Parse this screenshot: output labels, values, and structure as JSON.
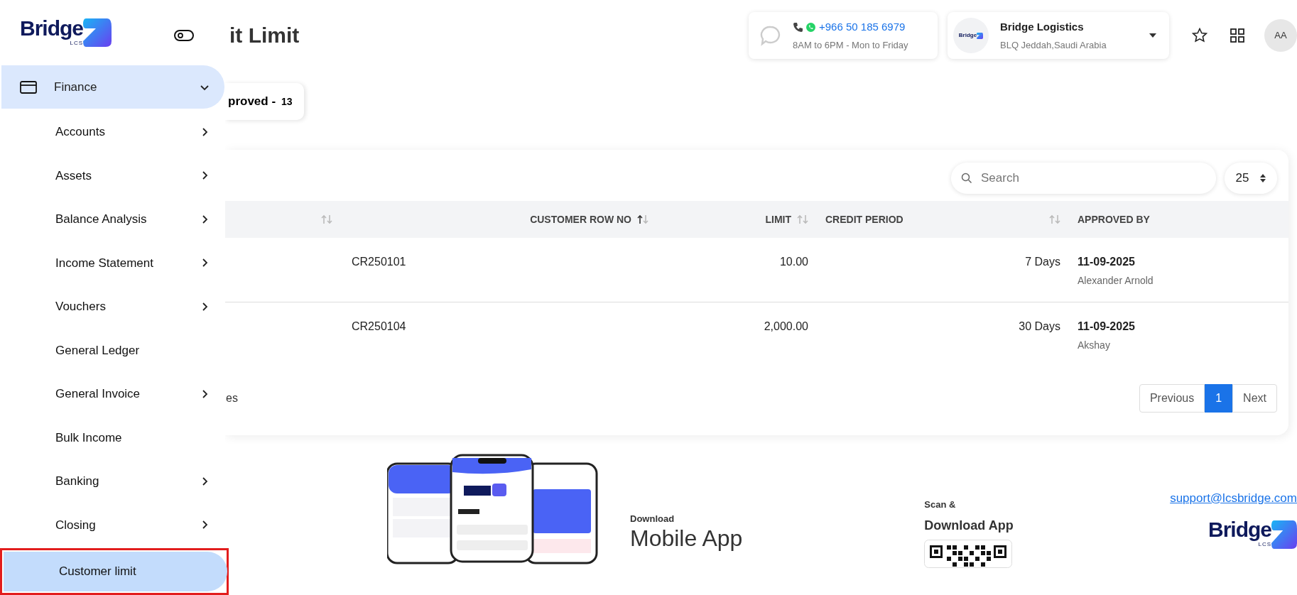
{
  "sidebar": {
    "logo": "Bridge",
    "logo_sub": "LCS",
    "section": {
      "label": "Finance",
      "expanded": true
    },
    "items": [
      {
        "label": "Accounts",
        "has_submenu": true,
        "selected": false,
        "outlined": false
      },
      {
        "label": "Assets",
        "has_submenu": true,
        "selected": false,
        "outlined": false
      },
      {
        "label": "Balance Analysis",
        "has_submenu": true,
        "selected": false,
        "outlined": false
      },
      {
        "label": "Income Statement",
        "has_submenu": true,
        "selected": false,
        "outlined": false
      },
      {
        "label": "Vouchers",
        "has_submenu": true,
        "selected": false,
        "outlined": false
      },
      {
        "label": "General Ledger",
        "has_submenu": false,
        "selected": false,
        "outlined": false
      },
      {
        "label": "General Invoice",
        "has_submenu": true,
        "selected": false,
        "outlined": false
      },
      {
        "label": "Bulk Income",
        "has_submenu": false,
        "selected": false,
        "outlined": false
      },
      {
        "label": "Banking",
        "has_submenu": true,
        "selected": false,
        "outlined": false
      },
      {
        "label": "Closing",
        "has_submenu": true,
        "selected": false,
        "outlined": false
      },
      {
        "label": "Customer limit",
        "has_submenu": false,
        "selected": true,
        "outlined": true
      }
    ]
  },
  "page": {
    "title": "it Limit"
  },
  "header": {
    "contact": {
      "phone": "+966 50 185 6979",
      "hours": "8AM to 6PM - Mon to Friday"
    },
    "company": {
      "logo": "Bridge",
      "name": "Bridge Logistics",
      "location": "BLQ Jeddah,Saudi Arabia"
    },
    "avatar": "AA"
  },
  "status_tabs": [
    {
      "label": "proved -",
      "count": "13",
      "selected": true
    }
  ],
  "search": {
    "placeholder": "Search"
  },
  "page_size": "25",
  "table": {
    "columns": [
      {
        "sortable": true,
        "sorted": false
      },
      {
        "label": "CUSTOMER ROW NO",
        "sortable": true,
        "sorted": true
      },
      {
        "label": "LIMIT",
        "sortable": true,
        "sorted": false
      },
      {
        "label": "CREDIT PERIOD",
        "sortable": true,
        "sorted": false
      },
      {
        "label": "APPROVED BY",
        "sortable": false
      }
    ],
    "rows": [
      {
        "row_no": "CR250101",
        "limit": "10.00",
        "credit_period": "7 Days",
        "approved_date": "11-09-2025",
        "approved_by": "Alexander Arnold"
      },
      {
        "row_no": "CR250104",
        "limit": "2,000.00",
        "credit_period": "30 Days",
        "approved_date": "11-09-2025",
        "approved_by": "Akshay"
      }
    ]
  },
  "table_info": "es",
  "pagination": [
    {
      "label": "Previous",
      "selected": false
    },
    {
      "label": "1",
      "selected": true
    },
    {
      "label": "Next",
      "selected": false
    }
  ],
  "footer": {
    "download_label": "Download",
    "download_title": "Mobile App",
    "scan_label": "Scan &",
    "scan_title": "Download App",
    "email": "support@lcsbridge.com",
    "logo": "Bridge",
    "logo_sub": "LCS"
  }
}
